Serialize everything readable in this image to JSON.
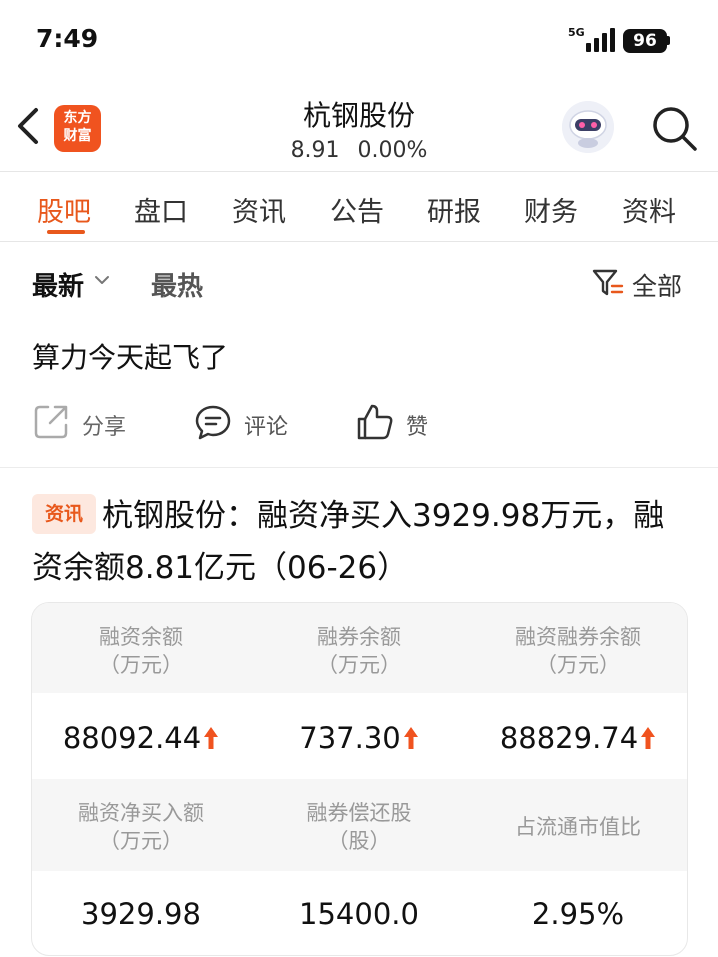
{
  "status_bar": {
    "time": "7:49",
    "network": "5G",
    "battery": "96"
  },
  "header": {
    "logo_line1": "东方",
    "logo_line2": "财富",
    "title": "杭钢股份",
    "price": "8.91",
    "change": "0.00%",
    "back_icon": "chevron-left-icon",
    "search_icon": "search-icon"
  },
  "tabs": [
    {
      "label": "股吧",
      "active": true
    },
    {
      "label": "盘口",
      "active": false
    },
    {
      "label": "资讯",
      "active": false
    },
    {
      "label": "公告",
      "active": false
    },
    {
      "label": "研报",
      "active": false
    },
    {
      "label": "财务",
      "active": false
    },
    {
      "label": "资料",
      "active": false
    }
  ],
  "sort": {
    "latest": "最新",
    "hot": "最热",
    "filter": "全部"
  },
  "post": {
    "text": "算力今天起飞了",
    "share": "分享",
    "comment": "评论",
    "like": "赞"
  },
  "news": {
    "tag": "资讯",
    "title": "杭钢股份：融资净买入3929.98万元，融资余额8.81亿元（06-26）",
    "rows": [
      {
        "headers": [
          {
            "line1": "融资余额",
            "line2": "（万元）"
          },
          {
            "line1": "融券余额",
            "line2": "（万元）"
          },
          {
            "line1": "融资融券余额",
            "line2": "（万元）"
          }
        ],
        "values": [
          "88092.44",
          "737.30",
          "88829.74"
        ],
        "trend_up": [
          true,
          true,
          true
        ]
      },
      {
        "headers": [
          {
            "line1": "融资净买入额",
            "line2": "（万元）"
          },
          {
            "line1": "融券偿还股",
            "line2": "（股）"
          },
          {
            "line1": "占流通市值比",
            "line2": ""
          }
        ],
        "values": [
          "3929.98",
          "15400.0",
          "2.95%"
        ],
        "trend_up": [
          false,
          false,
          false
        ]
      }
    ]
  },
  "colors": {
    "accent": "#e8581c",
    "up_arrow": "#f0531f",
    "logo_bg": "#f0531f"
  }
}
